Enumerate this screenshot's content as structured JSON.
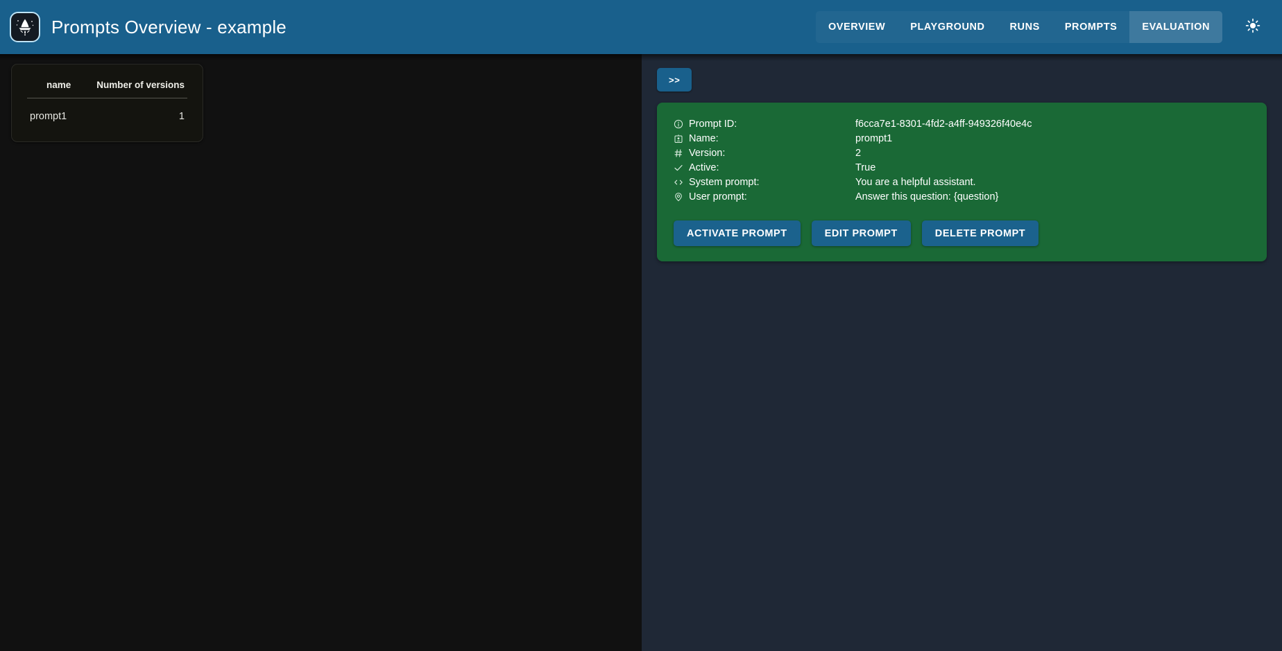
{
  "header": {
    "title": "Prompts Overview - example",
    "logo_icon": "wizard-hat-icon",
    "theme_toggle_icon": "sun-icon",
    "nav_tabs": [
      {
        "label": "OVERVIEW",
        "active": false
      },
      {
        "label": "PLAYGROUND",
        "active": false
      },
      {
        "label": "RUNS",
        "active": false
      },
      {
        "label": "PROMPTS",
        "active": false
      },
      {
        "label": "EVALUATION",
        "active": true
      }
    ]
  },
  "left_pane": {
    "table": {
      "columns": [
        "name",
        "Number of versions"
      ],
      "rows": [
        {
          "name": "prompt1",
          "versions": "1"
        }
      ]
    }
  },
  "right_pane": {
    "collapse_toggle_label": ">>",
    "detail_card": {
      "background_color": "#1a6936",
      "rows": [
        {
          "icon": "info-circle-icon",
          "label": "Prompt ID:",
          "value": "f6cca7e1-8301-4fd2-a4ff-949326f40e4c"
        },
        {
          "icon": "id-badge-icon",
          "label": "Name:",
          "value": "prompt1"
        },
        {
          "icon": "hash-icon",
          "label": "Version:",
          "value": "2"
        },
        {
          "icon": "check-icon",
          "label": "Active:",
          "value": "True"
        },
        {
          "icon": "code-brackets-icon",
          "label": "System prompt:",
          "value": "You are a helpful assistant."
        },
        {
          "icon": "map-pin-icon",
          "label": "User prompt:",
          "value": "Answer this question: {question}"
        }
      ],
      "actions": [
        {
          "label": "ACTIVATE PROMPT"
        },
        {
          "label": "EDIT PROMPT"
        },
        {
          "label": "DELETE PROMPT"
        }
      ]
    }
  },
  "colors": {
    "header_blue": "#19608c",
    "button_blue": "#1b628d",
    "detail_green": "#1a6936",
    "left_pane_bg": "#111111",
    "right_pane_bg": "#1f2836"
  }
}
